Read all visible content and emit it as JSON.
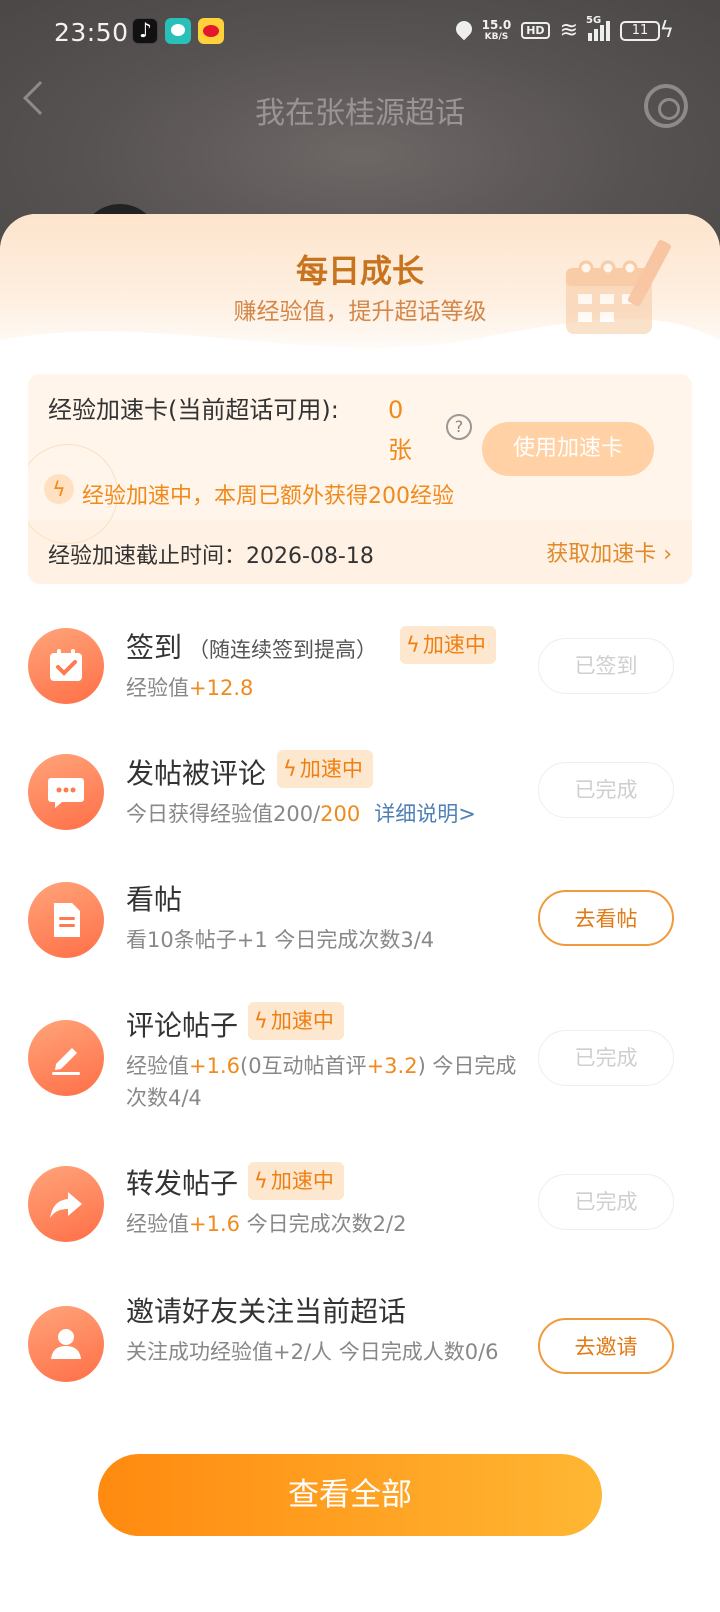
{
  "status_bar": {
    "time": "23:50",
    "net_speed_value": "15.0",
    "net_speed_unit": "KB/S",
    "hd": "HD",
    "network": "5G",
    "battery": "11"
  },
  "nav": {
    "title": "我在张桂源超话"
  },
  "sheet": {
    "title": "每日成长",
    "subtitle": "赚经验值，提升超话等级"
  },
  "speed_card": {
    "label": "经验加速卡(当前超话可用):",
    "count_value": "0",
    "count_unit": "张",
    "help": "?",
    "use_button": "使用加速卡",
    "boosting_text": "经验加速中，本周已额外获得200经验",
    "deadline_label": "经验加速截止时间：",
    "deadline_date": "2026-08-18",
    "get_card_link": "获取加速卡"
  },
  "tasks": [
    {
      "title": "签到",
      "title_note": "（随连续签到提高）",
      "badge": "加速中",
      "desc_prefix": "经验值",
      "desc_value": "+12.8",
      "button": "已签到",
      "icon": "calendar-check-icon"
    },
    {
      "title": "发帖被评论",
      "badge": "加速中",
      "desc_prefix": "今日获得经验值200/",
      "desc_value": "200",
      "desc_link": "详细说明>",
      "button": "已完成",
      "icon": "chat-bubble-icon"
    },
    {
      "title": "看帖",
      "desc": "看10条帖子+1   今日完成次数3/4",
      "button": "去看帖",
      "icon": "document-icon"
    },
    {
      "title": "评论帖子",
      "badge": "加速中",
      "desc_a": "经验值",
      "desc_b": "+1.6",
      "desc_c": "(0互动帖首评",
      "desc_d": "+3.2",
      "desc_e": ")   今日完成次数4/4",
      "button": "已完成",
      "icon": "edit-pen-icon"
    },
    {
      "title": "转发帖子",
      "badge": "加速中",
      "desc_a": "经验值",
      "desc_b": "+1.6",
      "desc_c": "   今日完成次数2/2",
      "button": "已完成",
      "icon": "share-arrow-icon"
    },
    {
      "title": "邀请好友关注当前超话",
      "desc": "关注成功经验值+2/人   今日完成人数0/6",
      "button": "去邀请",
      "icon": "user-icon"
    }
  ],
  "view_all_button": "查看全部",
  "colors": {
    "accent": "#f08a1c",
    "title_brown": "#c8741f",
    "icon_gradient_start": "#ffa47a",
    "icon_gradient_end": "#ff6f47",
    "link_blue": "#4e7fb6"
  }
}
